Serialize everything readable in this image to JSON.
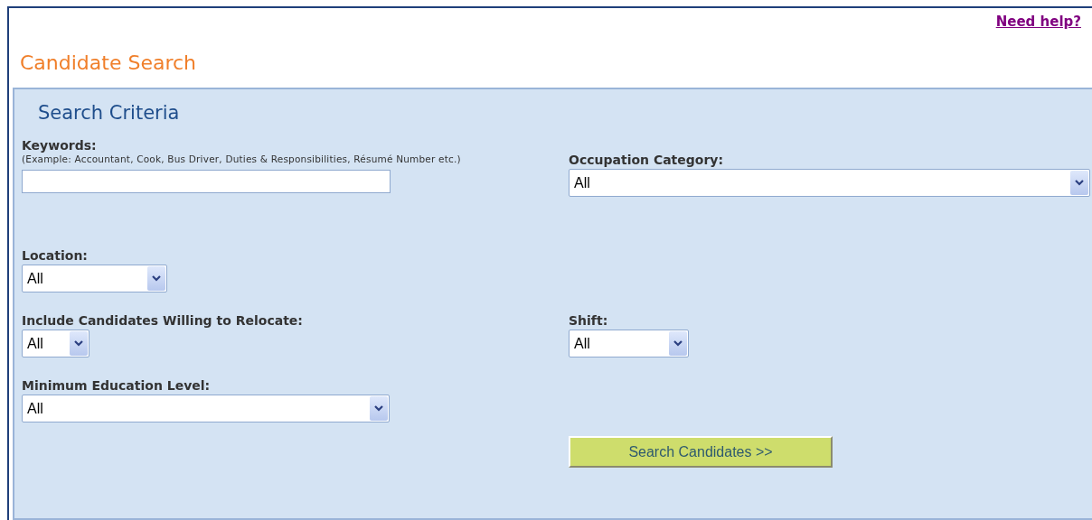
{
  "help_link": "Need help?",
  "page_title": "Candidate Search",
  "panel_title": "Search Criteria",
  "keywords": {
    "label": "Keywords:",
    "hint": "(Example: Accountant, Cook, Bus Driver, Duties & Responsibilities, Résumé Number etc.)"
  },
  "occupation_category": {
    "label": "Occupation Category:",
    "value": "All"
  },
  "location": {
    "label": "Location:",
    "value": "All"
  },
  "relocate": {
    "label": "Include Candidates Willing to Relocate:",
    "value": "All"
  },
  "shift": {
    "label": "Shift:",
    "value": "All"
  },
  "education": {
    "label": "Minimum Education Level:",
    "value": "All"
  },
  "search_button": "Search Candidates >>"
}
